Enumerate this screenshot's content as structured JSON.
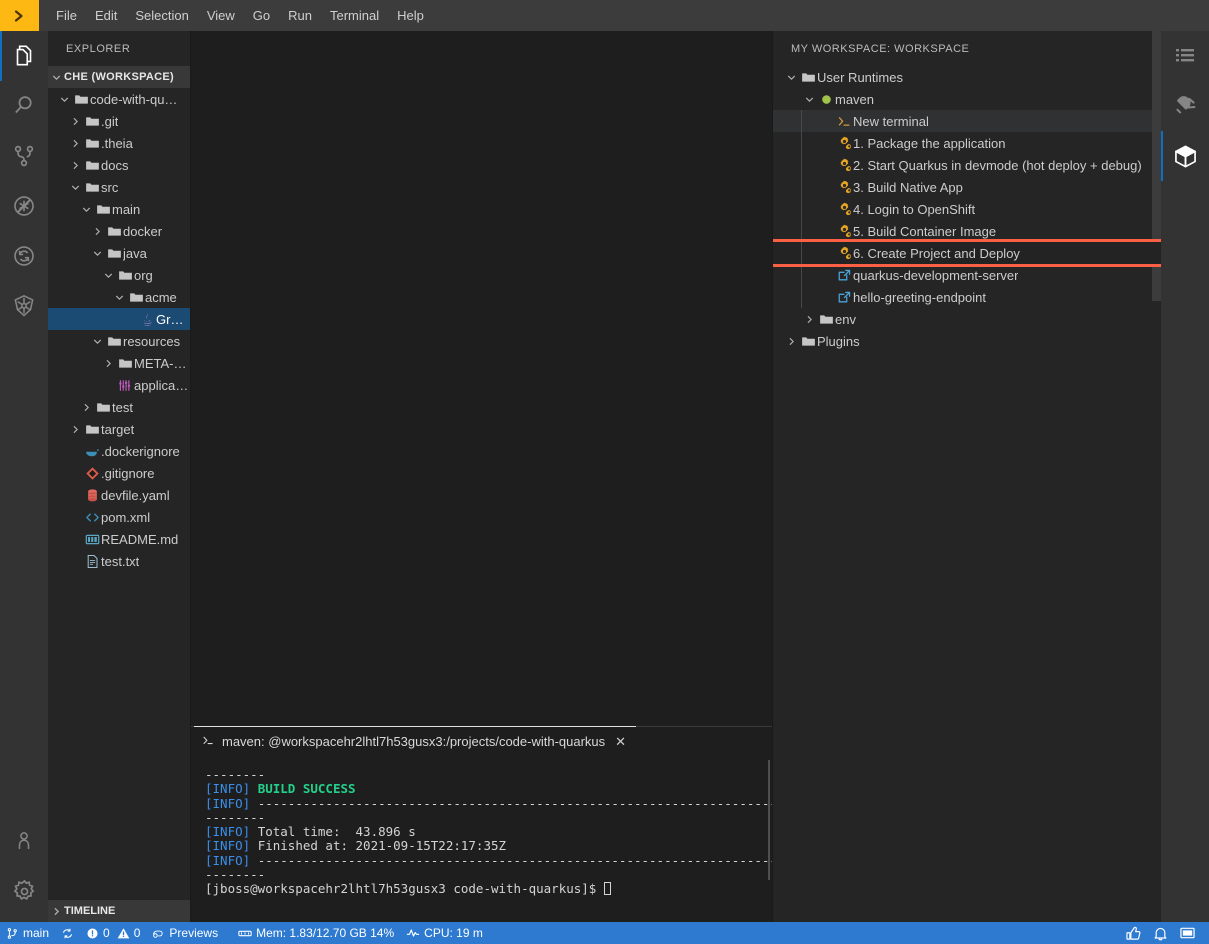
{
  "menubar": {
    "logo": "che-logo-icon",
    "items": [
      "File",
      "Edit",
      "Selection",
      "View",
      "Go",
      "Run",
      "Terminal",
      "Help"
    ]
  },
  "activity_bar_left": {
    "top": [
      {
        "name": "explorer-icon",
        "label": "Explorer",
        "active": true
      },
      {
        "name": "search-icon",
        "label": "Search",
        "active": false
      },
      {
        "name": "source-control-icon",
        "label": "Source Control",
        "active": false
      },
      {
        "name": "debug-icon",
        "label": "Run and Debug",
        "active": false
      },
      {
        "name": "sync-icon",
        "label": "Sync",
        "active": false
      },
      {
        "name": "kubernetes-icon",
        "label": "Kubernetes",
        "active": false
      }
    ],
    "bottom": [
      {
        "name": "account-icon",
        "label": "Accounts",
        "active": false
      },
      {
        "name": "settings-gear-icon",
        "label": "Manage",
        "active": false
      }
    ]
  },
  "activity_bar_right": {
    "items": [
      {
        "name": "outline-list-icon",
        "label": "Outline",
        "active": false
      },
      {
        "name": "plugin-plug-icon",
        "label": "Plugins",
        "active": false
      },
      {
        "name": "workspace-cube-icon",
        "label": "Workspace",
        "active": true
      }
    ]
  },
  "sidebar": {
    "title": "EXPLORER",
    "root_section": "CHE (WORKSPACE)",
    "timeline": "TIMELINE",
    "tree": [
      {
        "label": "code-with-qu…",
        "indent": 0,
        "twisty": "down",
        "icon": "folder-icon",
        "selected": false
      },
      {
        "label": ".git",
        "indent": 1,
        "twisty": "right",
        "icon": "folder-icon",
        "selected": false
      },
      {
        "label": ".theia",
        "indent": 1,
        "twisty": "right",
        "icon": "folder-icon",
        "selected": false
      },
      {
        "label": "docs",
        "indent": 1,
        "twisty": "right",
        "icon": "folder-icon",
        "selected": false
      },
      {
        "label": "src",
        "indent": 1,
        "twisty": "down",
        "icon": "folder-icon",
        "selected": false
      },
      {
        "label": "main",
        "indent": 2,
        "twisty": "down",
        "icon": "folder-icon",
        "selected": false
      },
      {
        "label": "docker",
        "indent": 3,
        "twisty": "right",
        "icon": "folder-icon",
        "selected": false
      },
      {
        "label": "java",
        "indent": 3,
        "twisty": "down",
        "icon": "folder-icon",
        "selected": false
      },
      {
        "label": "org",
        "indent": 4,
        "twisty": "down",
        "icon": "folder-icon",
        "selected": false
      },
      {
        "label": "acme",
        "indent": 5,
        "twisty": "down",
        "icon": "folder-icon",
        "selected": false
      },
      {
        "label": "Greeti…",
        "indent": 6,
        "twisty": "none",
        "icon": "java-file-icon",
        "selected": true
      },
      {
        "label": "resources",
        "indent": 3,
        "twisty": "down",
        "icon": "folder-icon",
        "selected": false
      },
      {
        "label": "META-INF",
        "indent": 4,
        "twisty": "right",
        "icon": "folder-icon",
        "selected": false
      },
      {
        "label": "applicati…",
        "indent": 4,
        "twisty": "none",
        "icon": "properties-file-icon",
        "selected": false
      },
      {
        "label": "test",
        "indent": 2,
        "twisty": "right",
        "icon": "folder-icon",
        "selected": false
      },
      {
        "label": "target",
        "indent": 1,
        "twisty": "right",
        "icon": "folder-icon",
        "selected": false
      },
      {
        "label": ".dockerignore",
        "indent": 1,
        "twisty": "none",
        "icon": "docker-file-icon",
        "selected": false
      },
      {
        "label": ".gitignore",
        "indent": 1,
        "twisty": "none",
        "icon": "git-file-icon",
        "selected": false
      },
      {
        "label": "devfile.yaml",
        "indent": 1,
        "twisty": "none",
        "icon": "yaml-file-icon",
        "selected": false
      },
      {
        "label": "pom.xml",
        "indent": 1,
        "twisty": "none",
        "icon": "xml-file-icon",
        "selected": false
      },
      {
        "label": "README.md",
        "indent": 1,
        "twisty": "none",
        "icon": "markdown-file-icon",
        "selected": false
      },
      {
        "label": "test.txt",
        "indent": 1,
        "twisty": "none",
        "icon": "text-file-icon",
        "selected": false
      }
    ]
  },
  "right_panel": {
    "title": "MY WORKSPACE: WORKSPACE",
    "tree": [
      {
        "label": "User Runtimes",
        "indent": 0,
        "twisty": "down",
        "icon": "folder-icon",
        "state": "normal"
      },
      {
        "label": "maven",
        "indent": 1,
        "twisty": "down",
        "icon": "running-dot-icon",
        "state": "normal"
      },
      {
        "label": "New terminal",
        "indent": 2,
        "twisty": "none",
        "icon": "terminal-prompt-icon",
        "state": "hovered"
      },
      {
        "label": "1. Package the application",
        "indent": 2,
        "twisty": "none",
        "icon": "gears-task-icon",
        "state": "normal"
      },
      {
        "label": "2. Start Quarkus in devmode (hot deploy + debug)",
        "indent": 2,
        "twisty": "none",
        "icon": "gears-task-icon",
        "state": "normal"
      },
      {
        "label": "3. Build Native App",
        "indent": 2,
        "twisty": "none",
        "icon": "gears-task-icon",
        "state": "normal"
      },
      {
        "label": "4. Login to OpenShift",
        "indent": 2,
        "twisty": "none",
        "icon": "gears-task-icon",
        "state": "normal"
      },
      {
        "label": "5. Build Container Image",
        "indent": 2,
        "twisty": "none",
        "icon": "gears-task-icon",
        "state": "normal"
      },
      {
        "label": "6. Create Project and Deploy",
        "indent": 2,
        "twisty": "none",
        "icon": "gears-task-icon",
        "state": "highlight"
      },
      {
        "label": "quarkus-development-server",
        "indent": 2,
        "twisty": "none",
        "icon": "external-link-icon",
        "state": "normal"
      },
      {
        "label": "hello-greeting-endpoint",
        "indent": 2,
        "twisty": "none",
        "icon": "external-link-icon",
        "state": "normal"
      },
      {
        "label": "env",
        "indent": 1,
        "twisty": "right",
        "icon": "folder-icon",
        "state": "normal"
      },
      {
        "label": "Plugins",
        "indent": 0,
        "twisty": "right",
        "icon": "folder-icon",
        "state": "normal"
      }
    ],
    "highlight_color": "#fb6044"
  },
  "terminal": {
    "tab_label": "maven: @workspacehr2lhtl7h53gusx3:/projects/code-with-quarkus",
    "tab_icon": "terminal-prompt-icon",
    "close_label": "✕",
    "lines": [
      {
        "kind": "dash",
        "text": "--------"
      },
      {
        "kind": "info_green",
        "tag": "[INFO]",
        "text": "BUILD SUCCESS"
      },
      {
        "kind": "info_rule",
        "tag": "[INFO]",
        "text": "------------------------------------------------------------------------"
      },
      {
        "kind": "dash",
        "text": "--------"
      },
      {
        "kind": "info_plain",
        "tag": "[INFO]",
        "text": "Total time:  43.896 s"
      },
      {
        "kind": "info_plain",
        "tag": "[INFO]",
        "text": "Finished at: 2021-09-15T22:17:35Z"
      },
      {
        "kind": "info_rule",
        "tag": "[INFO]",
        "text": "------------------------------------------------------------------------"
      },
      {
        "kind": "dash",
        "text": "--------"
      },
      {
        "kind": "prompt",
        "text": "[jboss@workspacehr2lhtl7h53gusx3 code-with-quarkus]$ "
      }
    ]
  },
  "statusbar": {
    "branch": "main",
    "sync_icon": "sync-icon",
    "errors": "0",
    "warnings": "0",
    "previews": "Previews",
    "memory": "Mem: 1.83/12.70 GB 14%",
    "cpu": "CPU: 19 m",
    "right_icons": [
      {
        "name": "thumbs-up-icon"
      },
      {
        "name": "bell-icon"
      },
      {
        "name": "layout-panel-icon"
      }
    ],
    "background": "#2e7ad1"
  }
}
